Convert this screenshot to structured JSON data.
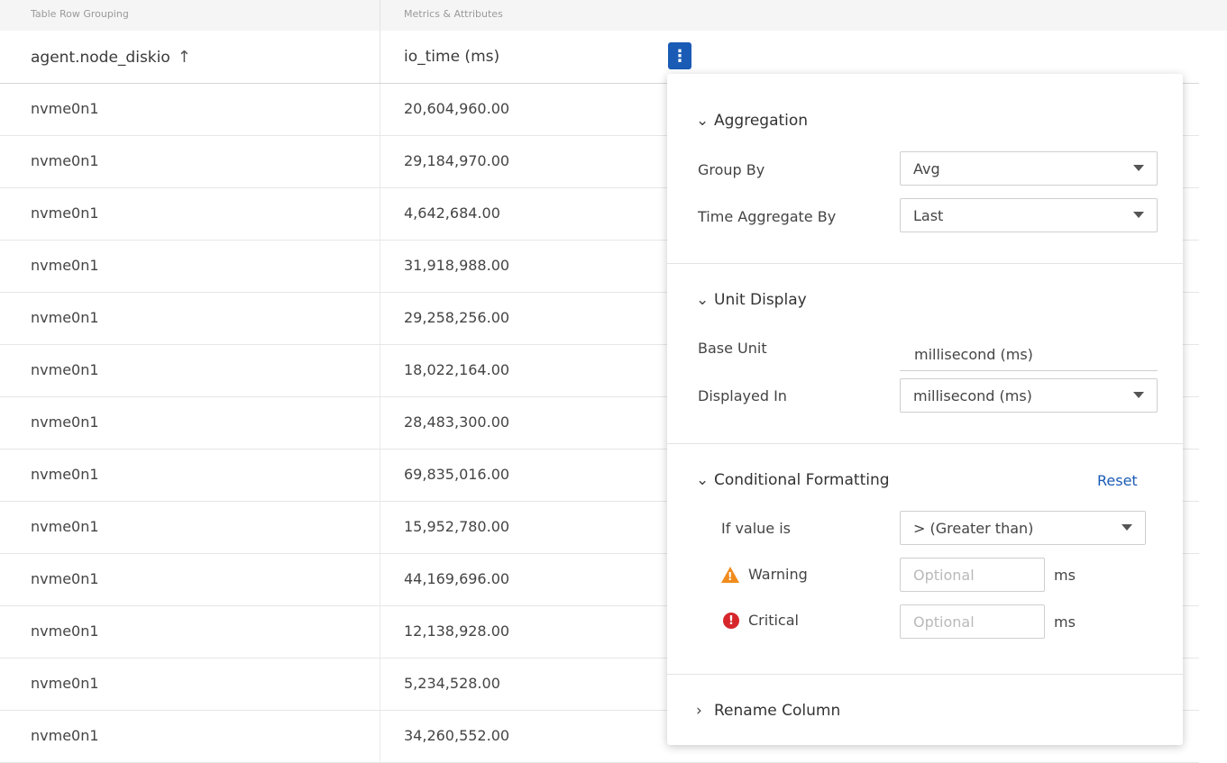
{
  "group_headers": {
    "row_grouping": "Table Row Grouping",
    "metrics": "Metrics & Attributes"
  },
  "columns": {
    "grouping_col": "agent.node_diskio",
    "metric_col": "io_time (ms)"
  },
  "icons": {
    "sort": "arrow-up-icon",
    "menu": "kebab-menu-icon",
    "warning": "warning-triangle-icon",
    "critical": "critical-exclamation-icon"
  },
  "rows": [
    {
      "node": "nvme0n1",
      "value": "20,604,960.00"
    },
    {
      "node": "nvme0n1",
      "value": "29,184,970.00"
    },
    {
      "node": "nvme0n1",
      "value": "4,642,684.00"
    },
    {
      "node": "nvme0n1",
      "value": "31,918,988.00"
    },
    {
      "node": "nvme0n1",
      "value": "29,258,256.00"
    },
    {
      "node": "nvme0n1",
      "value": "18,022,164.00"
    },
    {
      "node": "nvme0n1",
      "value": "28,483,300.00"
    },
    {
      "node": "nvme0n1",
      "value": "69,835,016.00"
    },
    {
      "node": "nvme0n1",
      "value": "15,952,780.00"
    },
    {
      "node": "nvme0n1",
      "value": "44,169,696.00"
    },
    {
      "node": "nvme0n1",
      "value": "12,138,928.00"
    },
    {
      "node": "nvme0n1",
      "value": "5,234,528.00"
    },
    {
      "node": "nvme0n1",
      "value": "34,260,552.00"
    }
  ],
  "panel": {
    "aggregation": {
      "title": "Aggregation",
      "group_by_label": "Group By",
      "group_by_value": "Avg",
      "time_agg_label": "Time Aggregate By",
      "time_agg_value": "Last"
    },
    "unit_display": {
      "title": "Unit Display",
      "base_unit_label": "Base Unit",
      "base_unit_value": "millisecond (ms)",
      "displayed_in_label": "Displayed In",
      "displayed_in_value": "millisecond (ms)"
    },
    "conditional_formatting": {
      "title": "Conditional Formatting",
      "reset_label": "Reset",
      "if_value_label": "If value is",
      "if_value_value": "> (Greater than)",
      "warning_label": "Warning",
      "warning_placeholder": "Optional",
      "warning_unit": "ms",
      "critical_label": "Critical",
      "critical_placeholder": "Optional",
      "critical_unit": "ms"
    },
    "rename_column": {
      "title": "Rename Column"
    }
  },
  "colors": {
    "accent": "#1a5bb5",
    "warning": "#f08c1e",
    "critical": "#d6262c"
  }
}
